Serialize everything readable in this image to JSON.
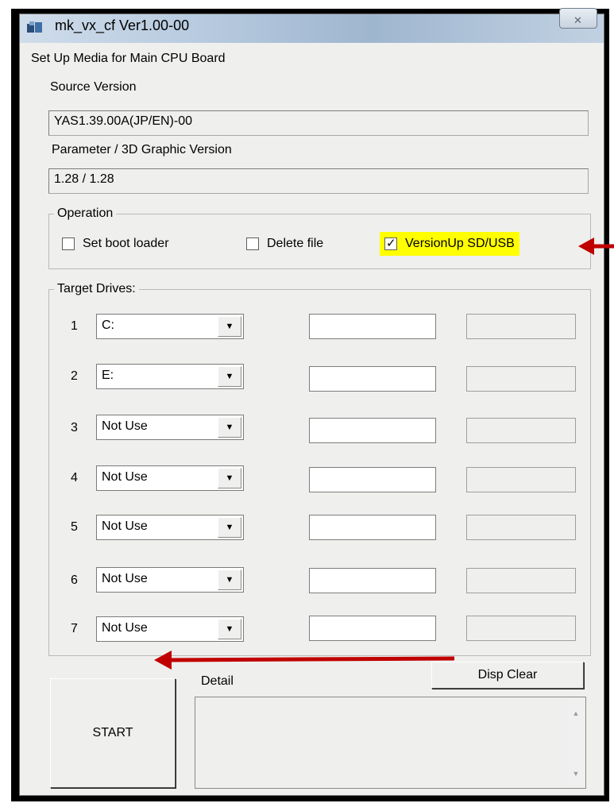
{
  "window": {
    "title": "mk_vx_cf Ver1.00-00",
    "icon": "app-icon",
    "close_icon": "close-icon"
  },
  "main": {
    "heading": "Set Up Media for Main CPU Board",
    "source_version_label": "Source Version",
    "source_version_value": "YAS1.39.00A(JP/EN)-00",
    "param_version_label": "Parameter / 3D Graphic Version",
    "param_version_value": "1.28 / 1.28"
  },
  "operation": {
    "legend": "Operation",
    "options": [
      {
        "label": "Set boot loader",
        "checked": false
      },
      {
        "label": "Delete file",
        "checked": false
      },
      {
        "label": "VersionUp SD/USB",
        "checked": true
      }
    ],
    "highlight_color": "#ffff00"
  },
  "target_drives": {
    "legend": "Target Drives:",
    "drives": [
      {
        "num": "1",
        "selected": "C:"
      },
      {
        "num": "2",
        "selected": "E:"
      },
      {
        "num": "3",
        "selected": "Not Use"
      },
      {
        "num": "4",
        "selected": "Not Use"
      },
      {
        "num": "5",
        "selected": "Not Use"
      },
      {
        "num": "6",
        "selected": "Not Use"
      },
      {
        "num": "7",
        "selected": "Not Use"
      }
    ]
  },
  "bottom": {
    "disp_clear_label": "Disp Clear",
    "detail_label": "Detail",
    "start_label": "START"
  },
  "annotation": {
    "arrow_color": "#c00000"
  }
}
